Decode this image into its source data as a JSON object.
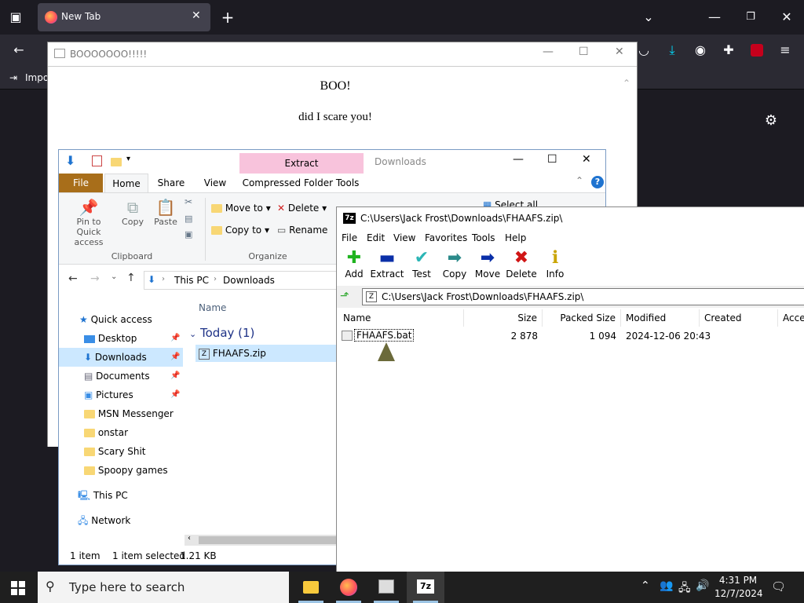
{
  "firefox": {
    "tab_title": "New Tab",
    "bookmark_import": "Impo"
  },
  "boo": {
    "title": "BOOOOOOO!!!!!",
    "heading": "BOO!",
    "line": "did I scare you!"
  },
  "explorer": {
    "title_tab_extract": "Extract",
    "title_text": "Downloads",
    "tabs": [
      "File",
      "Home",
      "Share",
      "View",
      "Compressed Folder Tools"
    ],
    "ribbon": {
      "pin": "Pin to Quick access",
      "copy": "Copy",
      "paste": "Paste",
      "clipboard": "Clipboard",
      "move_to": "Move to",
      "copy_to": "Copy to",
      "delete": "Delete",
      "rename": "Rename",
      "organize": "Organize",
      "select_all": "Select all"
    },
    "breadcrumb": [
      "This PC",
      "Downloads"
    ],
    "column_name": "Name",
    "group": "Today (1)",
    "file": "FHAAFS.zip",
    "nav": {
      "quick_access": "Quick access",
      "items": [
        "Desktop",
        "Downloads",
        "Documents",
        "Pictures",
        "MSN Messenger",
        "onstar",
        "Scary Shit",
        "Spoopy games"
      ],
      "this_pc": "This PC",
      "network": "Network"
    },
    "status": {
      "count": "1 item",
      "selected": "1 item selected",
      "size": "1.21 KB"
    }
  },
  "sevenzip": {
    "title": "C:\\Users\\Jack Frost\\Downloads\\FHAAFS.zip\\",
    "menu": [
      "File",
      "Edit",
      "View",
      "Favorites",
      "Tools",
      "Help"
    ],
    "toolbar": [
      "Add",
      "Extract",
      "Test",
      "Copy",
      "Move",
      "Delete",
      "Info"
    ],
    "path": "C:\\Users\\Jack Frost\\Downloads\\FHAAFS.zip\\",
    "columns": [
      "Name",
      "Size",
      "Packed Size",
      "Modified",
      "Created",
      "Acces"
    ],
    "rows": [
      {
        "name": "FHAAFS.bat",
        "size": "2 878",
        "packed": "1 094",
        "modified": "2024-12-06 20:43",
        "created": ""
      }
    ]
  },
  "taskbar": {
    "search_placeholder": "Type here to search",
    "time": "4:31 PM",
    "date": "12/7/2024"
  },
  "colors": {
    "firefox_bg": "#1c1b22",
    "explorer_file_tab": "#c68c2b",
    "extract_tab": "#f8c3dc",
    "taskbar": "#1f1f1f"
  }
}
